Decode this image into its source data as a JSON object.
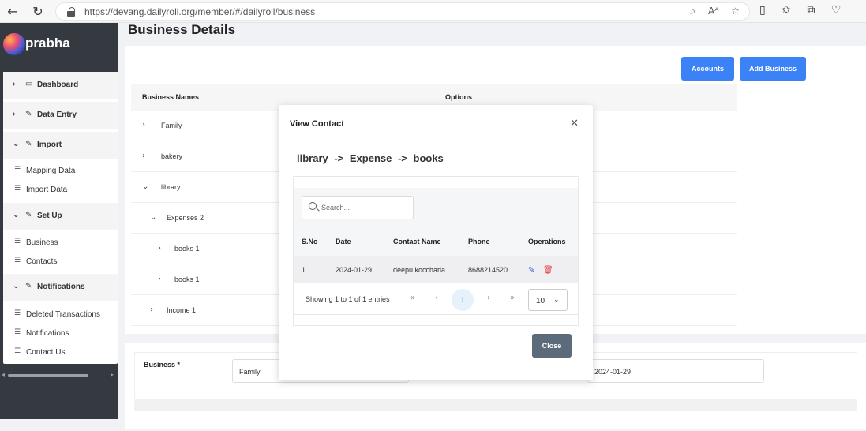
{
  "browser": {
    "url": "https://devang.dailyroll.org/member/#/dailyroll/business",
    "reader_label": "Aᴬ"
  },
  "sidebar": {
    "brand": "prabha",
    "sections": [
      {
        "label": "Dashboard",
        "expanded": false,
        "items": []
      },
      {
        "label": "Data Entry",
        "expanded": false,
        "items": []
      },
      {
        "label": "Import",
        "expanded": true,
        "items": [
          "Mapping Data",
          "Import Data"
        ]
      },
      {
        "label": "Set Up",
        "expanded": true,
        "items": [
          "Business",
          "Contacts"
        ]
      },
      {
        "label": "Notifications",
        "expanded": true,
        "items": [
          "Deleted Transactions",
          "Notifications",
          "Contact Us"
        ]
      }
    ]
  },
  "page": {
    "title": "Business Details",
    "accounts_button": "Accounts",
    "add_business_button": "Add Business"
  },
  "table": {
    "headers": [
      "Business Names",
      "Options"
    ],
    "rows": [
      {
        "label": "Family",
        "expanded": false
      },
      {
        "label": "bakery",
        "expanded": false
      },
      {
        "label": "library",
        "expanded": true
      },
      {
        "label": "Expenses 2",
        "expanded": true
      },
      {
        "label": "books 1",
        "expanded": false
      },
      {
        "label": "books 1",
        "expanded": false
      },
      {
        "label": "Income 1",
        "expanded": false
      }
    ]
  },
  "form": {
    "business_label": "Business *",
    "business_value": "Family",
    "date_value": "2024-01-29"
  },
  "modal": {
    "title": "View Contact",
    "crumb": "library -> Expense -> books",
    "search_placeholder": "Search...",
    "columns": [
      "S.No",
      "Date",
      "Contact Name",
      "Phone",
      "Operations"
    ],
    "rows": [
      {
        "sno": "1",
        "date": "2024-01-29",
        "name": "deepu koccharla",
        "phone": "8688214520"
      }
    ],
    "entries_text": "Showing 1 to 1 of 1 entries",
    "current_page": "1",
    "page_size": "10",
    "close_button": "Close"
  }
}
